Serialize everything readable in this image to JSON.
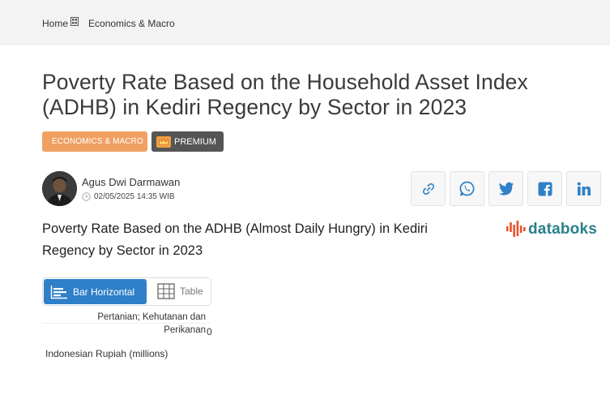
{
  "breadcrumb": {
    "home": "Home",
    "category": "Economics & Macro"
  },
  "article": {
    "title": "Poverty Rate Based on the Household Asset Index (ADHB) in Kediri Regency by Sector in 2023",
    "category_tag": "ECONOMICS & MACRO",
    "premium_tag": "PREMIUM",
    "author": "Agus Dwi Darmawan",
    "date": "02/05/2025 14:35 WIB"
  },
  "share_icons": [
    "link-icon",
    "whatsapp-icon",
    "twitter-icon",
    "facebook-icon",
    "linkedin-icon"
  ],
  "chart": {
    "title": "Poverty Rate Based on the ADHB (Almost Daily Hungry) in Kediri Regency by Sector in 2023",
    "logo": "databoks",
    "view_bar": "Bar Horizontal",
    "view_table": "Table"
  },
  "chart_data": {
    "type": "bar",
    "orientation": "horizontal",
    "categories": [
      "Pertanian; Kehutanan dan Perikanan"
    ],
    "values": [
      0
    ],
    "value_labels": [
      "0"
    ],
    "xlabel": "Indonesian Rupiah (millions)",
    "bar_color": "#2f80c8"
  },
  "colors": {
    "accent": "#2f80c8",
    "category_tag": "#f0a062",
    "premium_tag": "#555555",
    "logo": "#2a7f8a"
  }
}
